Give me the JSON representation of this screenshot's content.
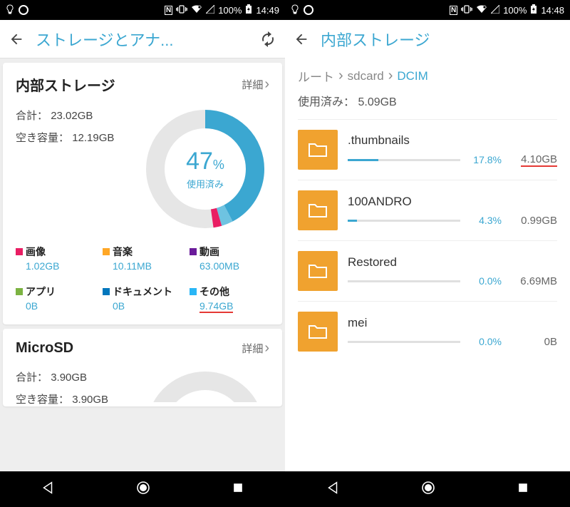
{
  "status": {
    "battery": "100%",
    "time1": "14:49",
    "time2": "14:48"
  },
  "screen1": {
    "title": "ストレージとアナ...",
    "card1": {
      "title": "内部ストレージ",
      "detail": "詳細",
      "totalLabel": "合計：",
      "totalValue": "23.02GB",
      "freeLabel": "空き容量：",
      "freeValue": "12.19GB",
      "percent": "47",
      "percentUnit": "%",
      "usedLabel": "使用済み"
    },
    "legend": [
      {
        "label": "画像",
        "value": "1.02GB",
        "color": "#e91e63"
      },
      {
        "label": "音楽",
        "value": "10.11MB",
        "color": "#ffa726"
      },
      {
        "label": "動画",
        "value": "63.00MB",
        "color": "#6a1b9a"
      },
      {
        "label": "アプリ",
        "value": "0B",
        "color": "#7cb342"
      },
      {
        "label": "ドキュメント",
        "value": "0B",
        "color": "#0277bd"
      },
      {
        "label": "その他",
        "value": "9.74GB",
        "color": "#29b6f6",
        "underline": true
      }
    ],
    "card2": {
      "title": "MicroSD",
      "detail": "詳細",
      "totalLabel": "合計：",
      "totalValue": "3.90GB",
      "freeLabel": "空き容量：",
      "freeValue": "3.90GB"
    }
  },
  "screen2": {
    "title": "内部ストレージ",
    "crumbRoot": "ルート",
    "crumbSd": "sdcard",
    "crumbCur": "DCIM",
    "usedLabel": "使用済み：",
    "usedValue": "5.09GB",
    "folders": [
      {
        "name": ".thumbnails",
        "pct": "17.8%",
        "size": "4.10GB",
        "fill": 27,
        "underline": true
      },
      {
        "name": "100ANDRO",
        "pct": "4.3%",
        "size": "0.99GB",
        "fill": 8
      },
      {
        "name": "Restored",
        "pct": "0.0%",
        "size": "6.69MB",
        "fill": 0
      },
      {
        "name": "mei",
        "pct": "0.0%",
        "size": "0B",
        "fill": 0
      }
    ]
  },
  "chart_data": {
    "type": "pie",
    "title": "内部ストレージ 使用済み 47%",
    "categories": [
      "画像",
      "音楽",
      "動画",
      "アプリ",
      "ドキュメント",
      "その他",
      "空き容量"
    ],
    "values_gb": [
      1.02,
      0.0099,
      0.0615,
      0,
      0,
      9.74,
      12.19
    ],
    "total_gb": 23.02,
    "used_percent": 47
  }
}
